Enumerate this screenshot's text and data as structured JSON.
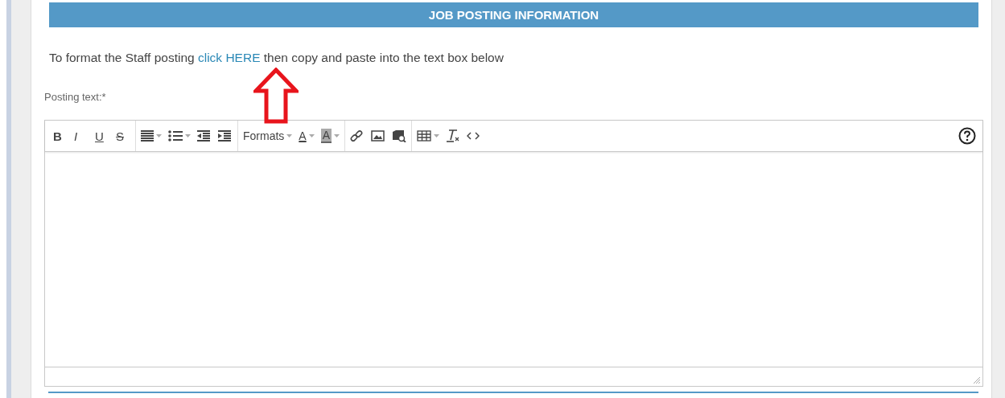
{
  "section": {
    "title": "JOB POSTING INFORMATION"
  },
  "instruction": {
    "before": "To format the Staff posting ",
    "link": "click HERE",
    "after": " then copy and paste into the text box below"
  },
  "annotation": {
    "kind": "arrow"
  },
  "field": {
    "label": "Posting text:*"
  },
  "toolbar": {
    "groups": [
      [
        {
          "kind": "bold",
          "label": "B"
        },
        {
          "kind": "italic",
          "label": "I"
        },
        {
          "kind": "underline",
          "label": "U"
        },
        {
          "kind": "strike",
          "label": "S"
        }
      ],
      [
        {
          "kind": "align",
          "dropdown": true
        },
        {
          "kind": "bullets",
          "dropdown": true
        },
        {
          "kind": "outdent",
          "dropdown": false
        },
        {
          "kind": "indent",
          "dropdown": false
        }
      ],
      [
        {
          "kind": "formats",
          "label": "Formats",
          "dropdown": true
        },
        {
          "kind": "forecolor",
          "label": "A",
          "dropdown": true
        },
        {
          "kind": "backcolor",
          "label": "A",
          "dropdown": true
        }
      ],
      [
        {
          "kind": "link",
          "dropdown": false
        },
        {
          "kind": "image",
          "dropdown": false
        },
        {
          "kind": "media",
          "dropdown": false
        }
      ],
      [
        {
          "kind": "table",
          "dropdown": true
        },
        {
          "kind": "clearformat",
          "dropdown": false
        },
        {
          "kind": "code",
          "dropdown": false
        }
      ]
    ]
  }
}
